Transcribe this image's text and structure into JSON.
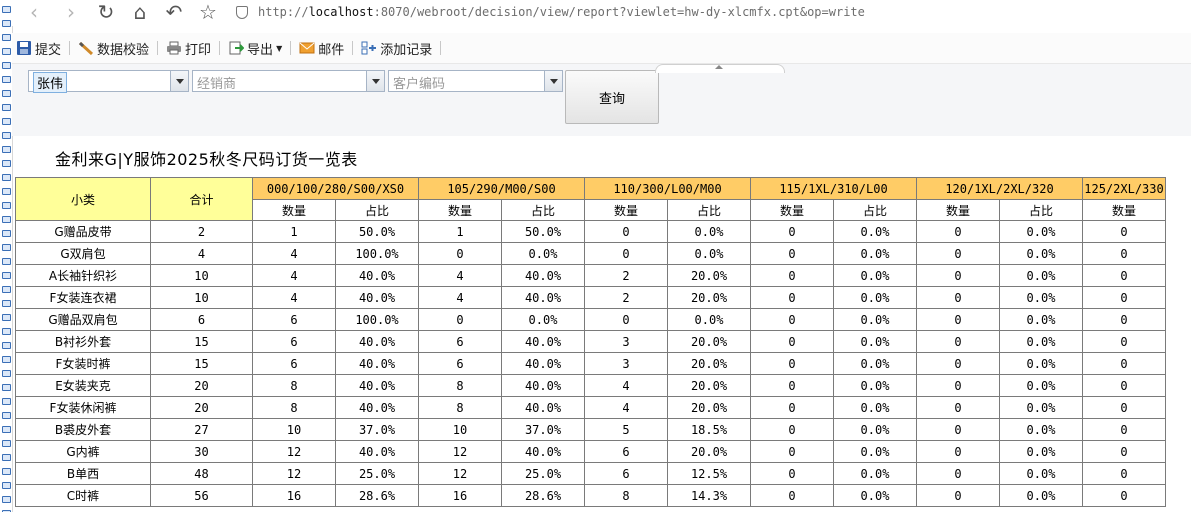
{
  "browser": {
    "url_host": "localhost",
    "url_rest": ":8070/webroot/decision/view/report?viewlet=hw-dy-xlcmfx.cpt&op=write",
    "url_scheme": "http://"
  },
  "toolbar": {
    "submit": "提交",
    "validate": "数据校验",
    "print": "打印",
    "export": "导出",
    "mail": "邮件",
    "add_record": "添加记录"
  },
  "params": {
    "salesperson_value": "张伟",
    "dealer_placeholder": "经销商",
    "customer_placeholder": "客户编码",
    "query_label": "查询"
  },
  "report": {
    "title": "金利来G|Y服饰2025秋冬尺码订货一览表",
    "col_category": "小类",
    "col_total": "合计",
    "sub_qty": "数量",
    "sub_ratio": "占比",
    "size_groups": [
      "000/100/280/S00/XS0",
      "105/290/M00/S00",
      "110/300/L00/M00",
      "115/1XL/310/L00",
      "120/1XL/2XL/320",
      "125/2XL/330"
    ],
    "rows": [
      {
        "cat": "G赠品皮带",
        "total": "2",
        "cells": [
          "1",
          "50.0%",
          "1",
          "50.0%",
          "0",
          "0.0%",
          "0",
          "0.0%",
          "0",
          "0.0%",
          "0"
        ]
      },
      {
        "cat": "G双肩包",
        "total": "4",
        "cells": [
          "4",
          "100.0%",
          "0",
          "0.0%",
          "0",
          "0.0%",
          "0",
          "0.0%",
          "0",
          "0.0%",
          "0"
        ]
      },
      {
        "cat": "A长袖针织衫",
        "total": "10",
        "cells": [
          "4",
          "40.0%",
          "4",
          "40.0%",
          "2",
          "20.0%",
          "0",
          "0.0%",
          "0",
          "0.0%",
          "0"
        ]
      },
      {
        "cat": "F女装连衣裙",
        "total": "10",
        "cells": [
          "4",
          "40.0%",
          "4",
          "40.0%",
          "2",
          "20.0%",
          "0",
          "0.0%",
          "0",
          "0.0%",
          "0"
        ]
      },
      {
        "cat": "G赠品双肩包",
        "total": "6",
        "cells": [
          "6",
          "100.0%",
          "0",
          "0.0%",
          "0",
          "0.0%",
          "0",
          "0.0%",
          "0",
          "0.0%",
          "0"
        ]
      },
      {
        "cat": "B衬衫外套",
        "total": "15",
        "cells": [
          "6",
          "40.0%",
          "6",
          "40.0%",
          "3",
          "20.0%",
          "0",
          "0.0%",
          "0",
          "0.0%",
          "0"
        ]
      },
      {
        "cat": "F女装时裤",
        "total": "15",
        "cells": [
          "6",
          "40.0%",
          "6",
          "40.0%",
          "3",
          "20.0%",
          "0",
          "0.0%",
          "0",
          "0.0%",
          "0"
        ]
      },
      {
        "cat": "E女装夹克",
        "total": "20",
        "cells": [
          "8",
          "40.0%",
          "8",
          "40.0%",
          "4",
          "20.0%",
          "0",
          "0.0%",
          "0",
          "0.0%",
          "0"
        ]
      },
      {
        "cat": "F女装休闲裤",
        "total": "20",
        "cells": [
          "8",
          "40.0%",
          "8",
          "40.0%",
          "4",
          "20.0%",
          "0",
          "0.0%",
          "0",
          "0.0%",
          "0"
        ]
      },
      {
        "cat": "B裘皮外套",
        "total": "27",
        "cells": [
          "10",
          "37.0%",
          "10",
          "37.0%",
          "5",
          "18.5%",
          "0",
          "0.0%",
          "0",
          "0.0%",
          "0"
        ]
      },
      {
        "cat": "G内裤",
        "total": "30",
        "cells": [
          "12",
          "40.0%",
          "12",
          "40.0%",
          "6",
          "20.0%",
          "0",
          "0.0%",
          "0",
          "0.0%",
          "0"
        ]
      },
      {
        "cat": "B单西",
        "total": "48",
        "cells": [
          "12",
          "25.0%",
          "12",
          "25.0%",
          "6",
          "12.5%",
          "0",
          "0.0%",
          "0",
          "0.0%",
          "0"
        ]
      },
      {
        "cat": "C时裤",
        "total": "56",
        "cells": [
          "16",
          "28.6%",
          "16",
          "28.6%",
          "8",
          "14.3%",
          "0",
          "0.0%",
          "0",
          "0.0%",
          "0"
        ]
      }
    ]
  },
  "colors": {
    "header_yellow": "#ffff99",
    "header_orange": "#ffcc66"
  }
}
